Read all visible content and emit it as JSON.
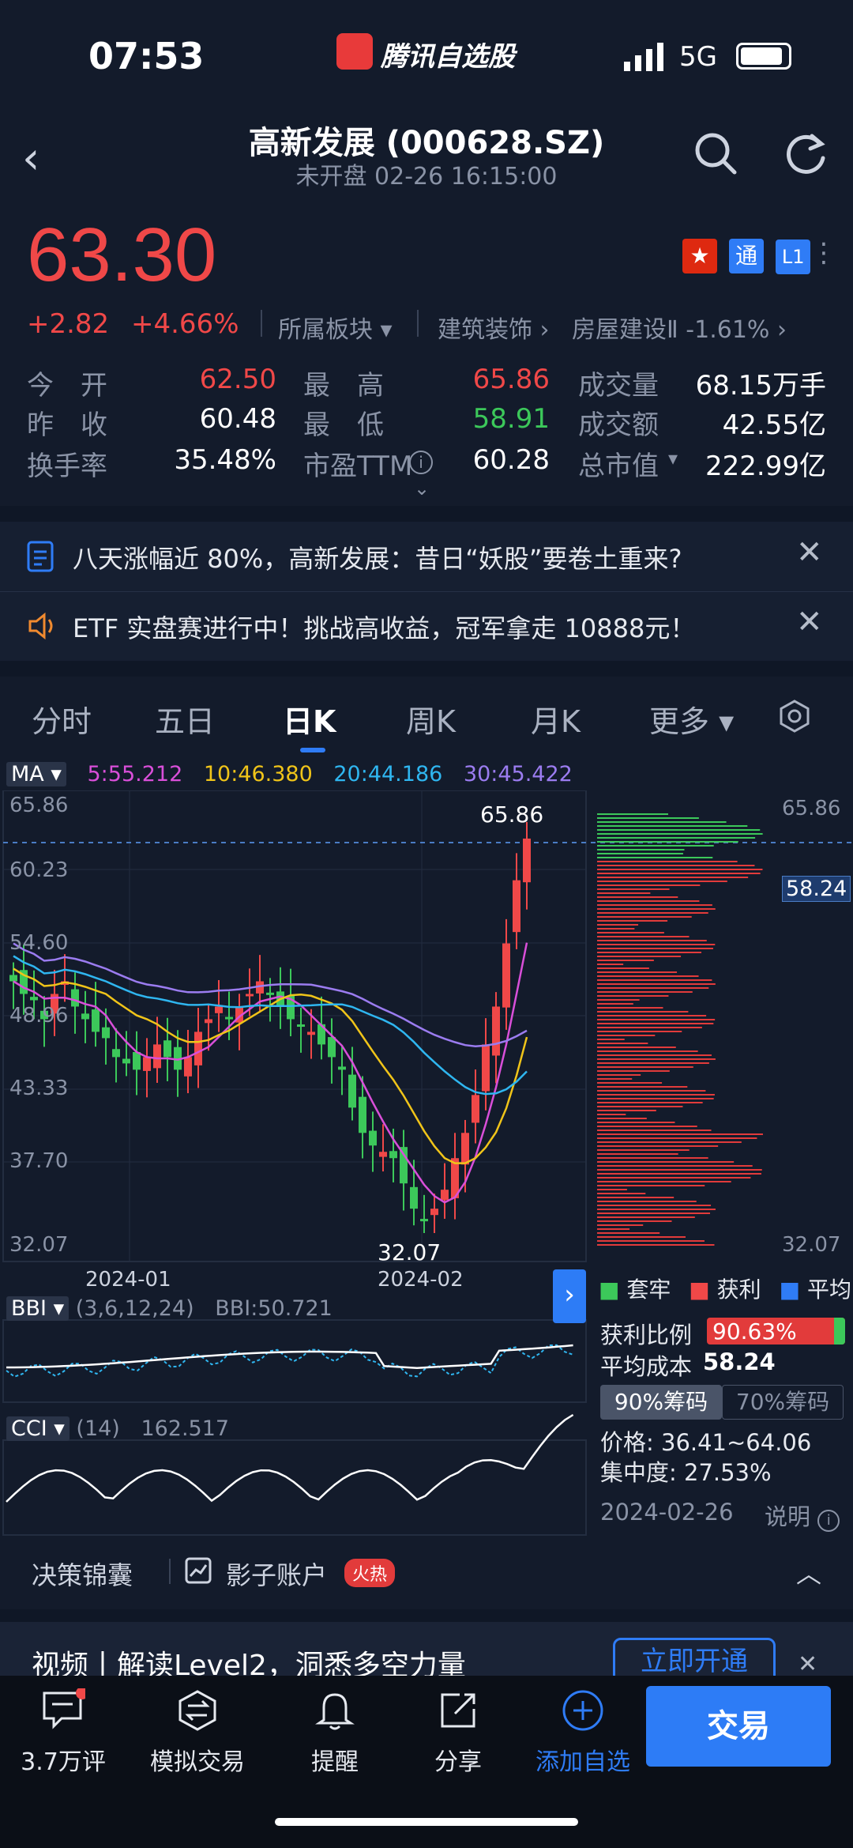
{
  "status": {
    "time": "07:53",
    "network": "5G"
  },
  "app": {
    "brand": "腾讯自选股"
  },
  "header": {
    "title": "高新发展 (000628.SZ)",
    "subtitle": "未开盘   02-26 16:15:00"
  },
  "quote": {
    "price": "63.30",
    "change": "+2.82",
    "change_pct": "+4.66%",
    "sector_label": "所属板块",
    "industry": "建筑装饰",
    "sub_industry": "房屋建设Ⅱ -1.61%",
    "badge_tong": "通",
    "badge_l1": "L1",
    "stats": {
      "open_label": "今　开",
      "open": "62.50",
      "high_label": "最　高",
      "high": "65.86",
      "volume_label": "成交量",
      "volume": "68.15万手",
      "prev_label": "昨　收",
      "prev": "60.48",
      "low_label": "最　低",
      "low": "58.91",
      "amount_label": "成交额",
      "amount": "42.55亿",
      "turnover_label": "换手率",
      "turnover": "35.48%",
      "pe_label": "市盈TTM",
      "pe": "60.28",
      "mcap_label": "总市值",
      "mcap": "222.99亿"
    }
  },
  "news": [
    {
      "text": "八天涨幅近 80%，高新发展：昔日“妖股”要卷土重来?"
    },
    {
      "text": "ETF 实盘赛进行中！挑战高收益，冠军拿走 10888元！"
    }
  ],
  "tabs": [
    "分时",
    "五日",
    "日K",
    "周K",
    "月K",
    "更多"
  ],
  "ma": {
    "label": "MA",
    "ma5": "5:55.212",
    "ma10": "10:46.380",
    "ma20": "20:44.186",
    "ma30": "30:45.422"
  },
  "axis": {
    "y_ticks": [
      "65.86",
      "60.23",
      "54.60",
      "48.96",
      "43.33",
      "37.70",
      "32.07"
    ],
    "x_ticks": [
      "2024-01",
      "2024-02"
    ],
    "high_mark": "65.86",
    "low_mark": "32.07"
  },
  "chip": {
    "top": "65.86",
    "avg_tag": "58.24",
    "bottom": "32.07",
    "legend": [
      "套牢",
      "获利",
      "平均"
    ],
    "profit_label": "获利比例",
    "profit_value": "90.63%",
    "avg_cost_label": "平均成本",
    "avg_cost": "58.24",
    "btn90": "90%筹码",
    "btn70": "70%筹码",
    "price_range": "价格: 36.41~64.06",
    "concentration": "集中度: 27.53%",
    "date": "2024-02-26",
    "explain": "说明"
  },
  "bbi": {
    "label": "BBI",
    "params": "(3,6,12,24)",
    "value": "BBI:50.721"
  },
  "cci": {
    "label": "CCI",
    "params": "(14)",
    "value": "162.517"
  },
  "decision": {
    "left": "决策锦囊",
    "right": "影子账户",
    "hot": "火热"
  },
  "promo": {
    "text": "视频丨解读Level2，洞悉多空力量",
    "button": "立即开通"
  },
  "bottom_nav": {
    "comments": "3.7万评",
    "sim": "模拟交易",
    "remind": "提醒",
    "share": "分享",
    "add": "添加自选",
    "trade": "交易"
  },
  "colors": {
    "up": "#f04848",
    "down": "#3cc85a",
    "accent": "#2f7cf6",
    "ma5": "#d94fd9",
    "ma10": "#f0c419",
    "ma20": "#2fb6f0",
    "ma30": "#9b7cf0"
  }
}
